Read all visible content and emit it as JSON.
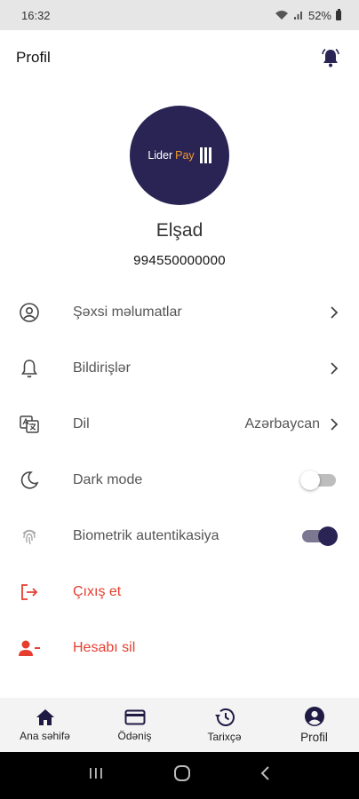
{
  "status_bar": {
    "time": "16:32",
    "battery": "52%"
  },
  "header": {
    "title": "Profil"
  },
  "profile": {
    "logo_lider": "Lider",
    "logo_pay": "Pay",
    "name": "Elşad",
    "phone": "994550000000"
  },
  "menu": {
    "personal_info": "Şəxsi məlumatlar",
    "notifications": "Bildirişlər",
    "language_label": "Dil",
    "language_value": "Azərbaycan",
    "dark_mode": "Dark mode",
    "dark_mode_enabled": false,
    "biometric": "Biometrik autentikasiya",
    "biometric_enabled": true,
    "logout": "Çıxış et",
    "delete_account": "Hesabı sil"
  },
  "bottom_nav": {
    "home": "Ana səhifə",
    "payment": "Ödəniş",
    "history": "Tarixçə",
    "profile": "Profil",
    "active": "profile"
  },
  "colors": {
    "brand": "#2a2454",
    "accent_orange": "#f29a2e",
    "danger": "#e53e30"
  }
}
